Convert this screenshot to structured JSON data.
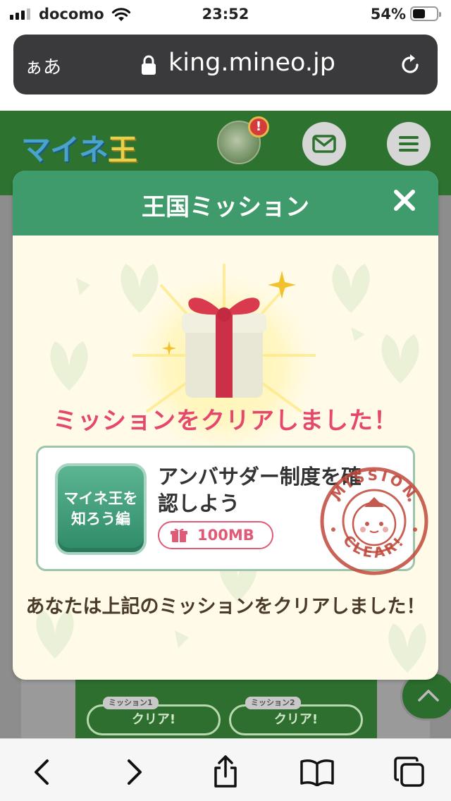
{
  "status_bar": {
    "carrier": "docomo",
    "time": "23:52",
    "battery_percent": "54%",
    "battery_level": 0.54
  },
  "address_bar": {
    "text_size_label": "ぁあ",
    "url": "king.mineo.jp"
  },
  "site": {
    "logo_text": "マイネ",
    "logo_text_2": "王",
    "notification_badge": "!",
    "bg_missions": [
      {
        "tag": "ミッション1",
        "label": "クリア!"
      },
      {
        "tag": "ミッション2",
        "label": "クリア!"
      }
    ]
  },
  "modal": {
    "title": "王国ミッション",
    "clear_message": "ミッションをクリアしました！",
    "mission": {
      "category_badge": "マイネ王を\n知ろう編",
      "title": "アンバサダー制度を確認しよう",
      "reward": "100MB"
    },
    "stamp": {
      "top_text": "MISSION",
      "bottom_text": "CLEAR!"
    },
    "result_message": "あなたは上記のミッションをクリアしました！"
  },
  "colors": {
    "header_green": "#3f9b6b",
    "site_green": "#2e7230",
    "accent_pink": "#e5476d",
    "stamp_red": "#c0483a",
    "modal_bg": "#fffbe8"
  },
  "icons": {
    "close": "close-icon",
    "lock": "lock-icon",
    "reload": "reload-icon",
    "mail": "mail-icon",
    "menu": "menu-icon",
    "gift": "gift-icon",
    "back": "back-icon",
    "forward": "forward-icon",
    "share": "share-icon",
    "bookmarks": "bookmarks-icon",
    "tabs": "tabs-icon"
  }
}
